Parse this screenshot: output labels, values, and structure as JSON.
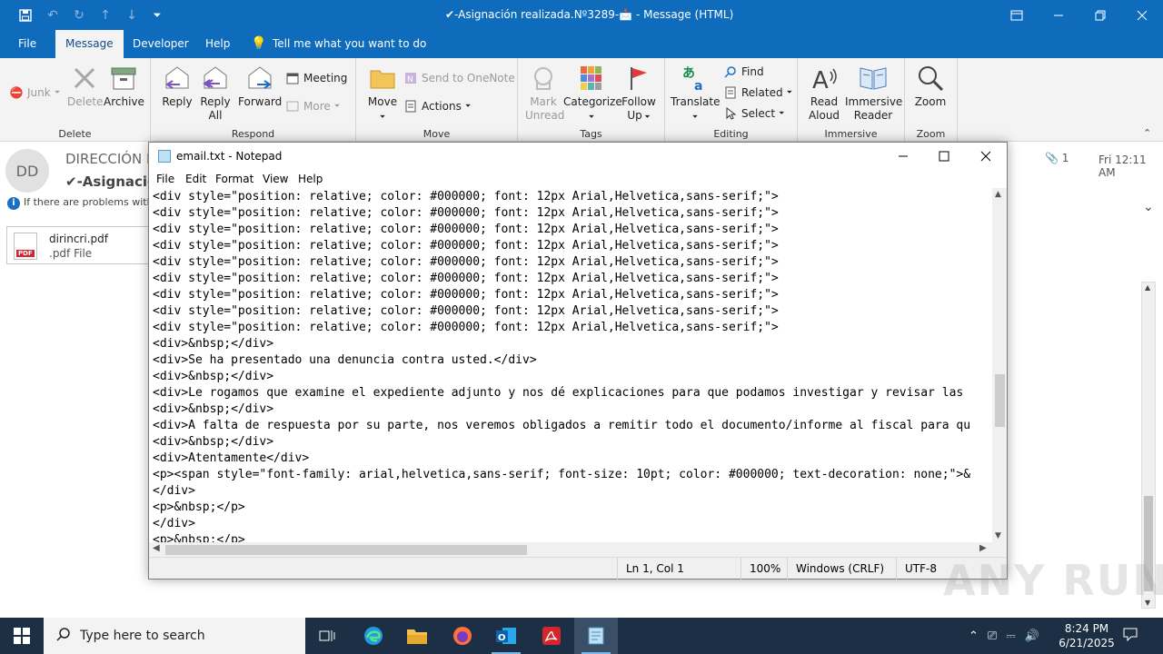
{
  "outlook": {
    "window_title": "✔-Asignación realizada.Nº3289-📩 - Message (HTML)",
    "tabs": [
      "File",
      "Message",
      "Developer",
      "Help"
    ],
    "active_tab": "Message",
    "tell_me": "Tell me what you want to do",
    "ribbon": {
      "delete_group": {
        "junk": "Junk",
        "delete": "Delete",
        "archive": "Archive",
        "label": "Delete"
      },
      "respond_group": {
        "reply": "Reply",
        "reply_all_1": "Reply",
        "reply_all_2": "All",
        "forward": "Forward",
        "meeting": "Meeting",
        "more": "More",
        "label": "Respond"
      },
      "move_group": {
        "move": "Move",
        "onenote": "Send to OneNote",
        "actions": "Actions",
        "label": "Move"
      },
      "tags_group": {
        "mark_unread_1": "Mark",
        "mark_unread_2": "Unread",
        "categorize": "Categorize",
        "follow_up_1": "Follow",
        "follow_up_2": "Up",
        "label": "Tags"
      },
      "editing_group": {
        "translate": "Translate",
        "find": "Find",
        "related": "Related",
        "select": "Select",
        "label": "Editing"
      },
      "immersive_group": {
        "read_aloud_1": "Read",
        "read_aloud_2": "Aloud",
        "immersive_reader_1": "Immersive",
        "immersive_reader_2": "Reader",
        "label": "Immersive"
      },
      "zoom_group": {
        "zoom": "Zoom",
        "label": "Zoom"
      }
    },
    "message": {
      "avatar_initials": "DD",
      "sender": "DIRECCIÓN D",
      "subject": "✔-Asignación",
      "info_bar": "If there are problems with",
      "attachment_name": "dirincri.pdf",
      "attachment_type": ".pdf File",
      "attachment_count": "1",
      "date": "Fri 12:11 AM"
    }
  },
  "notepad": {
    "title": "email.txt - Notepad",
    "menu": [
      "File",
      "Edit",
      "Format",
      "View",
      "Help"
    ],
    "lines": [
      "<div style=\"position: relative; color: #000000; font: 12px Arial,Helvetica,sans-serif;\">",
      "<div style=\"position: relative; color: #000000; font: 12px Arial,Helvetica,sans-serif;\">",
      "<div style=\"position: relative; color: #000000; font: 12px Arial,Helvetica,sans-serif;\">",
      "<div style=\"position: relative; color: #000000; font: 12px Arial,Helvetica,sans-serif;\">",
      "<div style=\"position: relative; color: #000000; font: 12px Arial,Helvetica,sans-serif;\">",
      "<div style=\"position: relative; color: #000000; font: 12px Arial,Helvetica,sans-serif;\">",
      "<div style=\"position: relative; color: #000000; font: 12px Arial,Helvetica,sans-serif;\">",
      "<div style=\"position: relative; color: #000000; font: 12px Arial,Helvetica,sans-serif;\">",
      "<div style=\"position: relative; color: #000000; font: 12px Arial,Helvetica,sans-serif;\">",
      "<div>&nbsp;</div>",
      "<div>Se ha presentado una denuncia contra usted.</div>",
      "<div>&nbsp;</div>",
      "<div>Le rogamos que examine el expediente adjunto y nos dé explicaciones para que podamos investigar y revisar las",
      "<div>&nbsp;</div>",
      "<div>A falta de respuesta por su parte, nos veremos obligados a remitir todo el documento/informe al fiscal para qu",
      "<div>&nbsp;</div>",
      "<div>Atentamente</div>",
      "<p><span style=\"font-family: arial,helvetica,sans-serif; font-size: 10pt; color: #000000; text-decoration: none;\">&",
      "</div>",
      "<p>&nbsp;</p>",
      "</div>",
      "<p>&nbsp;</p>"
    ],
    "status": {
      "position": "Ln 1, Col 1",
      "zoom": "100%",
      "line_ending": "Windows (CRLF)",
      "encoding": "UTF-8"
    }
  },
  "taskbar": {
    "search_placeholder": "Type here to search",
    "time": "8:24 PM",
    "date": "6/21/2025"
  },
  "watermark": "ANY RUN",
  "colors": {
    "outlook_blue": "#0f6cbd",
    "taskbar": "#1c2f45"
  }
}
